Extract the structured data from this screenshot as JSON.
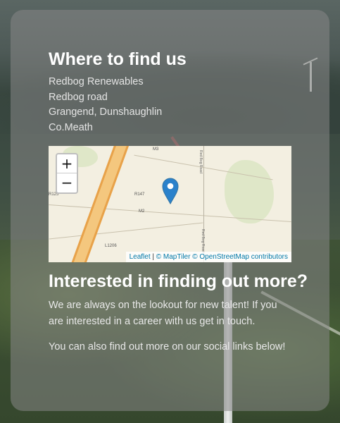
{
  "location": {
    "heading": "Where to find us",
    "address_lines": [
      "Redbog Renewables",
      "Redbog road",
      "Grangend, Dunshaughlin",
      "Co.Meath"
    ]
  },
  "map": {
    "zoom_in_label": "+",
    "zoom_out_label": "−",
    "road_labels": [
      "M3",
      "R147",
      "R125",
      "L1206",
      "M2",
      "Red Bog Road",
      "Red Bog Road"
    ],
    "attribution": {
      "leaflet": "Leaflet",
      "separator": " | ",
      "maptiler": "© MapTiler",
      "osm": "© OpenStreetMap contributors"
    },
    "colors": {
      "marker": "#2a81cb",
      "motorway": "#f4c77e",
      "land": "#f3efe1"
    }
  },
  "careers": {
    "heading": "Interested in finding out more?",
    "paragraph1": "We are always on the lookout for new talent! If you are interested in a career with us get in touch.",
    "paragraph2": "You can also find out more on our social links below!"
  }
}
